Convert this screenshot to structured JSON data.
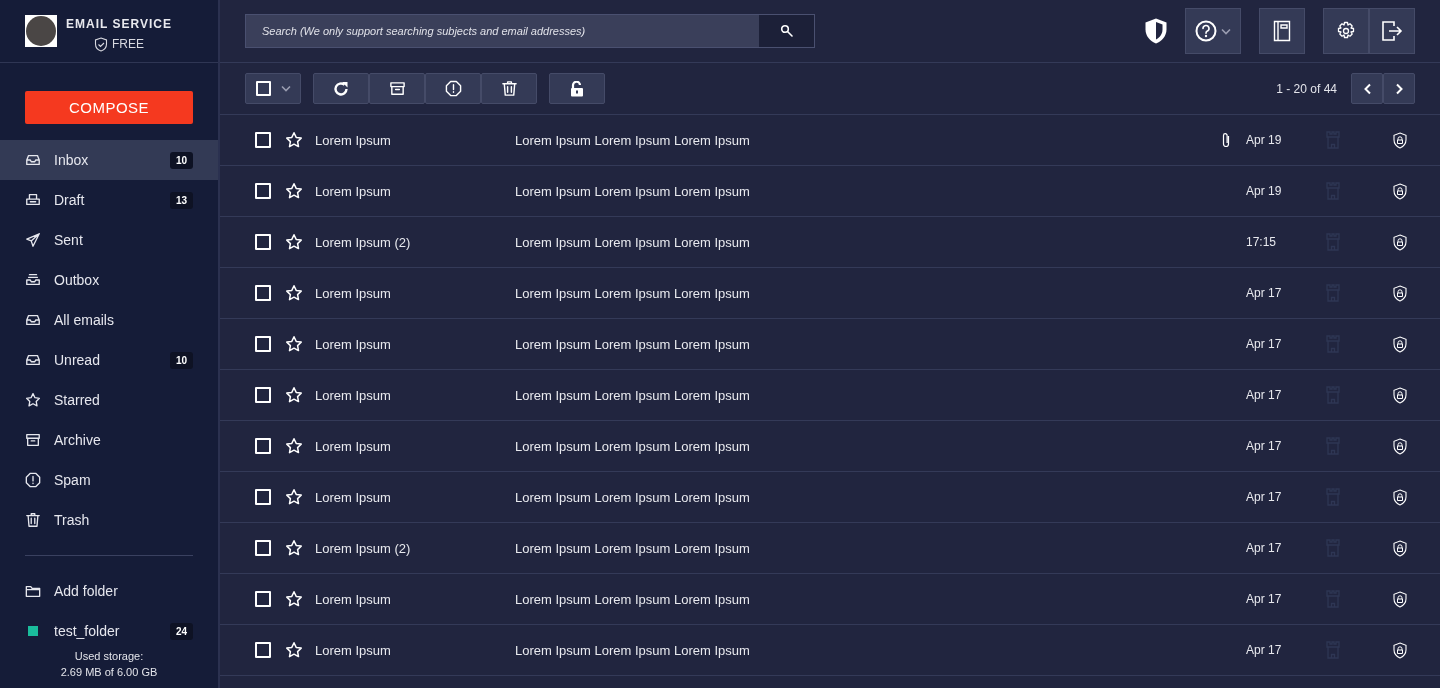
{
  "brand": {
    "name": "EMAIL SERVICE",
    "plan": "FREE"
  },
  "compose": "COMPOSE",
  "sidebar": {
    "items": [
      {
        "kind": "inbox",
        "label": "Inbox",
        "count": "10",
        "selected": true
      },
      {
        "kind": "draft",
        "label": "Draft",
        "count": "13",
        "selected": false
      },
      {
        "kind": "sent",
        "label": "Sent",
        "selected": false
      },
      {
        "kind": "outbox",
        "label": "Outbox",
        "selected": false
      },
      {
        "kind": "all",
        "label": "All emails",
        "selected": false
      },
      {
        "kind": "inbox",
        "label": "Unread",
        "count": "10",
        "selected": false
      },
      {
        "kind": "star",
        "label": "Starred",
        "selected": false
      },
      {
        "kind": "archive",
        "label": "Archive",
        "selected": false
      },
      {
        "kind": "spam",
        "label": "Spam",
        "selected": false
      },
      {
        "kind": "trash",
        "label": "Trash",
        "selected": false
      }
    ],
    "add_folder": "Add folder",
    "folders": [
      {
        "label": "test_folder",
        "count": "24",
        "color": "#1abc9c"
      }
    ],
    "storage": {
      "label": "Used storage:",
      "value": "2.69 MB of 6.00 GB"
    }
  },
  "search": {
    "placeholder": "Search (We only support searching subjects and email addresses)"
  },
  "select_all": {
    "checked": false
  },
  "pagination": "1 - 20 of 44",
  "emails": [
    {
      "sender": "Lorem Ipsum",
      "subject": "Lorem Ipsum Lorem Ipsum Lorem Ipsum",
      "attachment": true,
      "date": "Apr 19",
      "checked": false,
      "starred": false
    },
    {
      "sender": "Lorem Ipsum",
      "subject": "Lorem Ipsum Lorem Ipsum Lorem Ipsum",
      "attachment": false,
      "date": "Apr 19",
      "checked": false,
      "starred": false
    },
    {
      "sender": "Lorem Ipsum (2)",
      "subject": "Lorem Ipsum Lorem Ipsum Lorem Ipsum",
      "attachment": false,
      "date": "17:15",
      "checked": false,
      "starred": false
    },
    {
      "sender": "Lorem Ipsum",
      "subject": "Lorem Ipsum Lorem Ipsum Lorem Ipsum",
      "attachment": false,
      "date": "Apr 17",
      "checked": false,
      "starred": false
    },
    {
      "sender": "Lorem Ipsum",
      "subject": "Lorem Ipsum Lorem Ipsum Lorem Ipsum",
      "attachment": false,
      "date": "Apr 17",
      "checked": false,
      "starred": false
    },
    {
      "sender": "Lorem Ipsum",
      "subject": "Lorem Ipsum Lorem Ipsum Lorem Ipsum",
      "attachment": false,
      "date": "Apr 17",
      "checked": false,
      "starred": false
    },
    {
      "sender": "Lorem Ipsum",
      "subject": "Lorem Ipsum Lorem Ipsum Lorem Ipsum",
      "attachment": false,
      "date": "Apr 17",
      "checked": false,
      "starred": false
    },
    {
      "sender": "Lorem Ipsum",
      "subject": "Lorem Ipsum Lorem Ipsum Lorem Ipsum",
      "attachment": false,
      "date": "Apr 17",
      "checked": false,
      "starred": false
    },
    {
      "sender": "Lorem Ipsum (2)",
      "subject": "Lorem Ipsum Lorem Ipsum Lorem Ipsum",
      "attachment": false,
      "date": "Apr 17",
      "checked": false,
      "starred": false
    },
    {
      "sender": "Lorem Ipsum",
      "subject": "Lorem Ipsum Lorem Ipsum Lorem Ipsum",
      "attachment": false,
      "date": "Apr 17",
      "checked": false,
      "starred": false
    },
    {
      "sender": "Lorem Ipsum",
      "subject": "Lorem Ipsum Lorem Ipsum Lorem Ipsum",
      "attachment": false,
      "date": "Apr 17",
      "checked": false,
      "starred": false
    }
  ]
}
